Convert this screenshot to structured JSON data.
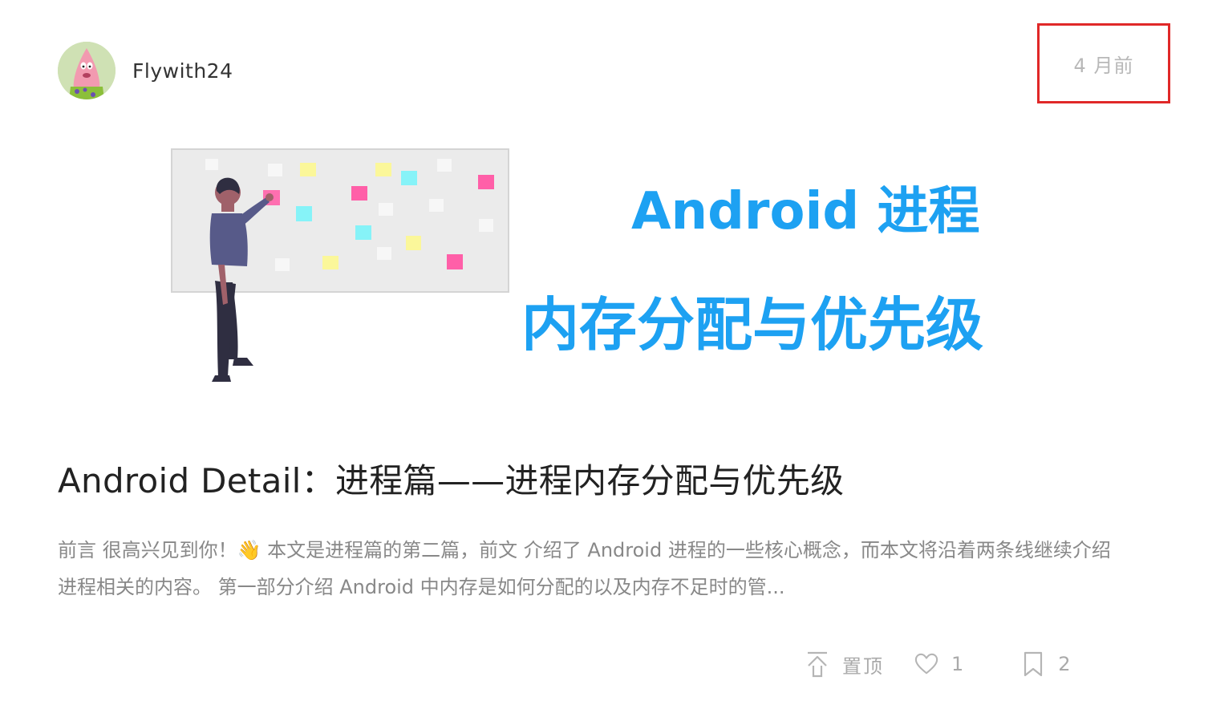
{
  "post": {
    "author": "Flywith24",
    "time": "4 月前",
    "cover": {
      "headline": "Android 进程",
      "subhead": "内存分配与优先级",
      "accent": "#1da1f2"
    },
    "title": "Android Detail：进程篇——进程内存分配与优先级",
    "summary": "前言 很高兴见到你！👋 本文是进程篇的第二篇，前文 介绍了 Android 进程的一些核心概念，而本文将沿着两条线继续介绍进程相关的内容。 第一部分介绍 Android 中内存是如何分配的以及内存不足时的管...",
    "actions": {
      "pin_label": "置顶",
      "likes": "1",
      "bookmarks": "2"
    }
  },
  "icons": {
    "pin": "pin-top-icon",
    "like": "heart-icon",
    "bookmark": "bookmark-icon"
  },
  "colors": {
    "highlight_border": "#e02828",
    "muted_text": "#aaaaaa"
  }
}
